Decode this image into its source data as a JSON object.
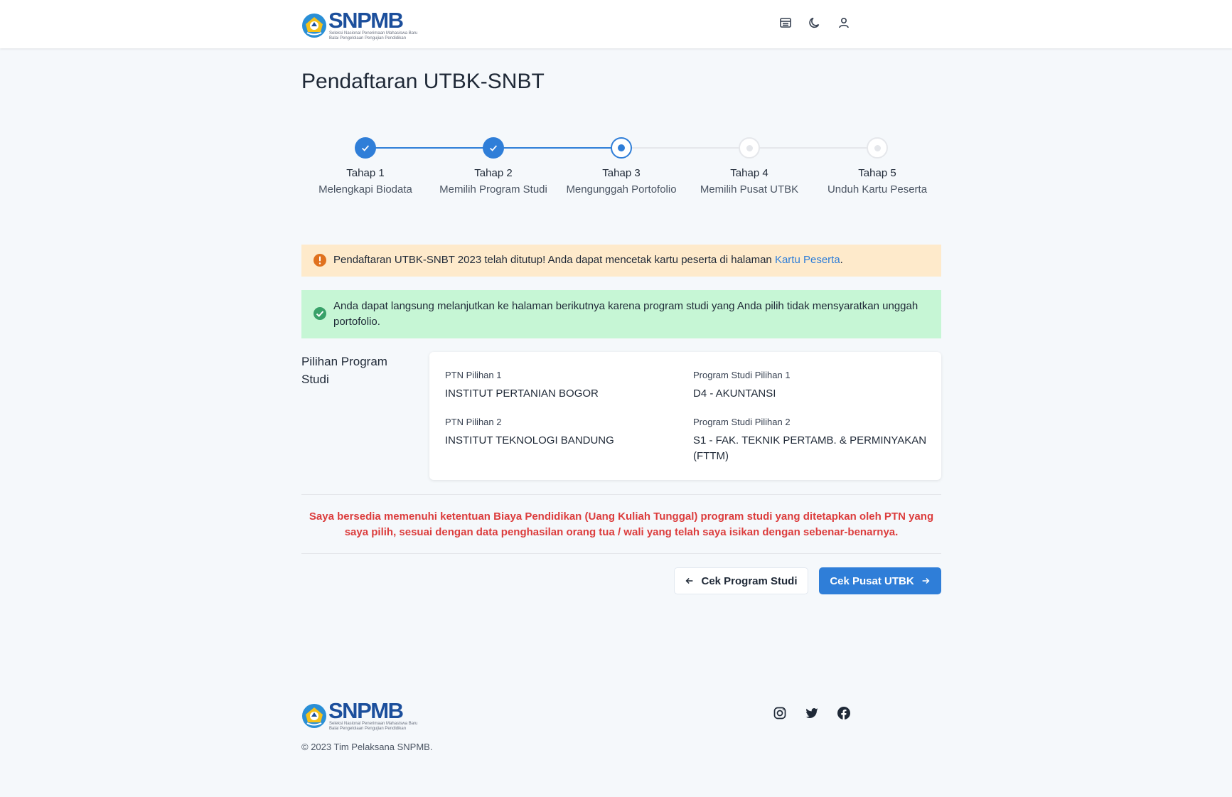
{
  "brand": {
    "name": "SNPMB",
    "tagline_top": "Seleksi Nasional Penerimaan Mahasiswa Baru",
    "tagline_bottom": "Balai Pengelolaan Pengujian Pendidikan"
  },
  "header_icons": [
    "table-icon",
    "moon-icon",
    "user-icon"
  ],
  "page": {
    "title": "Pendaftaran UTBK-SNBT"
  },
  "steps": [
    {
      "title": "Tahap 1",
      "desc": "Melengkapi Biodata",
      "status": "done"
    },
    {
      "title": "Tahap 2",
      "desc": "Memilih Program Studi",
      "status": "done"
    },
    {
      "title": "Tahap 3",
      "desc": "Mengunggah Portofolio",
      "status": "current"
    },
    {
      "title": "Tahap 4",
      "desc": "Memilih Pusat UTBK",
      "status": "todo"
    },
    {
      "title": "Tahap 5",
      "desc": "Unduh Kartu Peserta",
      "status": "todo"
    }
  ],
  "alerts": {
    "closed_text": "Pendaftaran UTBK-SNBT 2023 telah ditutup! Anda dapat mencetak kartu peserta di halaman ",
    "closed_link": "Kartu Peserta",
    "closed_end": ".",
    "portfolio_text": "Anda dapat langsung melanjutkan ke halaman berikutnya karena program studi yang Anda pilih tidak mensyaratkan unggah portofolio."
  },
  "program": {
    "section_label": "Pilihan Program Studi",
    "ptn1_label": "PTN Pilihan 1",
    "ptn1_value": "INSTITUT PERTANIAN BOGOR",
    "prodi1_label": "Program Studi Pilihan 1",
    "prodi1_value": "D4 - AKUNTANSI",
    "ptn2_label": "PTN Pilihan 2",
    "ptn2_value": "INSTITUT TEKNOLOGI BANDUNG",
    "prodi2_label": "Program Studi Pilihan 2",
    "prodi2_value": "S1 - FAK. TEKNIK PERTAMB. & PERMINYAKAN (FTTM)"
  },
  "declaration": "Saya bersedia memenuhi ketentuan Biaya Pendidikan (Uang Kuliah Tunggal) program studi yang ditetapkan oleh PTN yang saya pilih, sesuai dengan data penghasilan orang tua / wali yang telah saya isikan dengan sebenar-benarnya.",
  "buttons": {
    "back": "Cek Program Studi",
    "next": "Cek Pusat UTBK"
  },
  "footer": {
    "copyright": "© 2023 Tim Pelaksana SNPMB.",
    "social": [
      "instagram-icon",
      "twitter-icon",
      "facebook-icon"
    ]
  },
  "colors": {
    "primary": "#2f7ed8",
    "warning_bg": "#feeacb",
    "success_bg": "#c6f6d5",
    "danger_text": "#dc3d3d",
    "warning_icon": "#e0711e",
    "success_icon": "#38a169"
  }
}
